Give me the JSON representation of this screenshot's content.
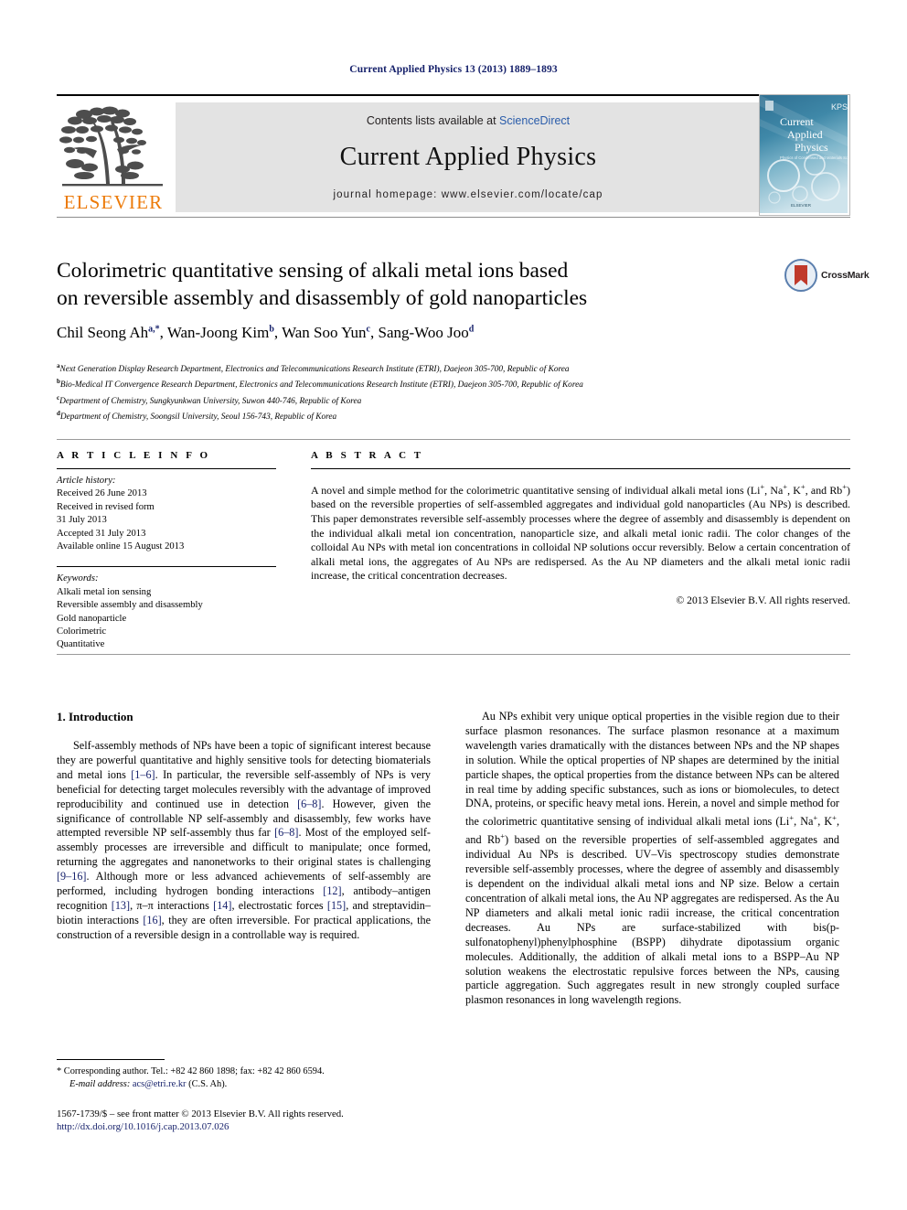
{
  "running_head": "Current Applied Physics 13 (2013) 1889–1893",
  "masthead": {
    "publisher_name": "ELSEVIER",
    "contents_prefix": "Contents lists available at ",
    "contents_link": "ScienceDirect",
    "journal_name": "Current Applied Physics",
    "homepage": "journal homepage: www.elsevier.com/locate/cap",
    "cover_title_line1": "Current",
    "cover_title_line2": "Applied",
    "cover_title_line3": "Physics",
    "cover_subtitle": "Physics of Condensed and Materials Science",
    "cover_badge": "KPS",
    "cover_publisher": "ELSEVIER"
  },
  "article": {
    "title_line1": "Colorimetric quantitative sensing of alkali metal ions based",
    "title_line2": "on reversible assembly and disassembly of gold nanoparticles",
    "crossmark_label": "CrossMark",
    "authors": [
      {
        "name": "Chil Seong Ah",
        "marks": "a,*",
        "sep": ", "
      },
      {
        "name": "Wan-Joong Kim",
        "marks": "b",
        "sep": ", "
      },
      {
        "name": "Wan Soo Yun",
        "marks": "c",
        "sep": ", "
      },
      {
        "name": "Sang-Woo Joo",
        "marks": "d",
        "sep": ""
      }
    ],
    "affiliations": [
      {
        "mark": "a",
        "text": "Next Generation Display Research Department, Electronics and Telecommunications Research Institute (ETRI), Daejeon 305-700, Republic of Korea"
      },
      {
        "mark": "b",
        "text": "Bio-Medical IT Convergence Research Department, Electronics and Telecommunications Research Institute (ETRI), Daejeon 305-700, Republic of Korea"
      },
      {
        "mark": "c",
        "text": "Department of Chemistry, Sungkyunkwan University, Suwon 440-746, Republic of Korea"
      },
      {
        "mark": "d",
        "text": "Department of Chemistry, Soongsil University, Seoul 156-743, Republic of Korea"
      }
    ]
  },
  "article_info": {
    "heading": "A R T I C L E   I N F O",
    "history_label": "Article history:",
    "history": [
      "Received 26 June 2013",
      "Received in revised form",
      "31 July 2013",
      "Accepted 31 July 2013",
      "Available online 15 August 2013"
    ],
    "keywords_label": "Keywords:",
    "keywords": [
      "Alkali metal ion sensing",
      "Reversible assembly and disassembly",
      "Gold nanoparticle",
      "Colorimetric",
      "Quantitative"
    ]
  },
  "abstract": {
    "heading": "A B S T R A C T",
    "copyright": "© 2013 Elsevier B.V. All rights reserved."
  },
  "introduction": {
    "heading": "1.  Introduction"
  },
  "footnote": {
    "corresponding": "* Corresponding author. Tel.: +82 42 860 1898; fax: +82 42 860 6594.",
    "email_label": "E-mail address:",
    "email": "acs@etri.re.kr",
    "email_suffix": "(C.S. Ah)."
  },
  "bottom": {
    "issn_line": "1567-1739/$ – see front matter © 2013 Elsevier B.V. All rights reserved.",
    "doi": "http://dx.doi.org/10.1016/j.cap.2013.07.026"
  },
  "colors": {
    "navy": "#16216b",
    "elsevier_orange": "#ec7a08",
    "sciencedirect_blue": "#2a5caa",
    "masthead_grey": "#e3e3e3"
  }
}
